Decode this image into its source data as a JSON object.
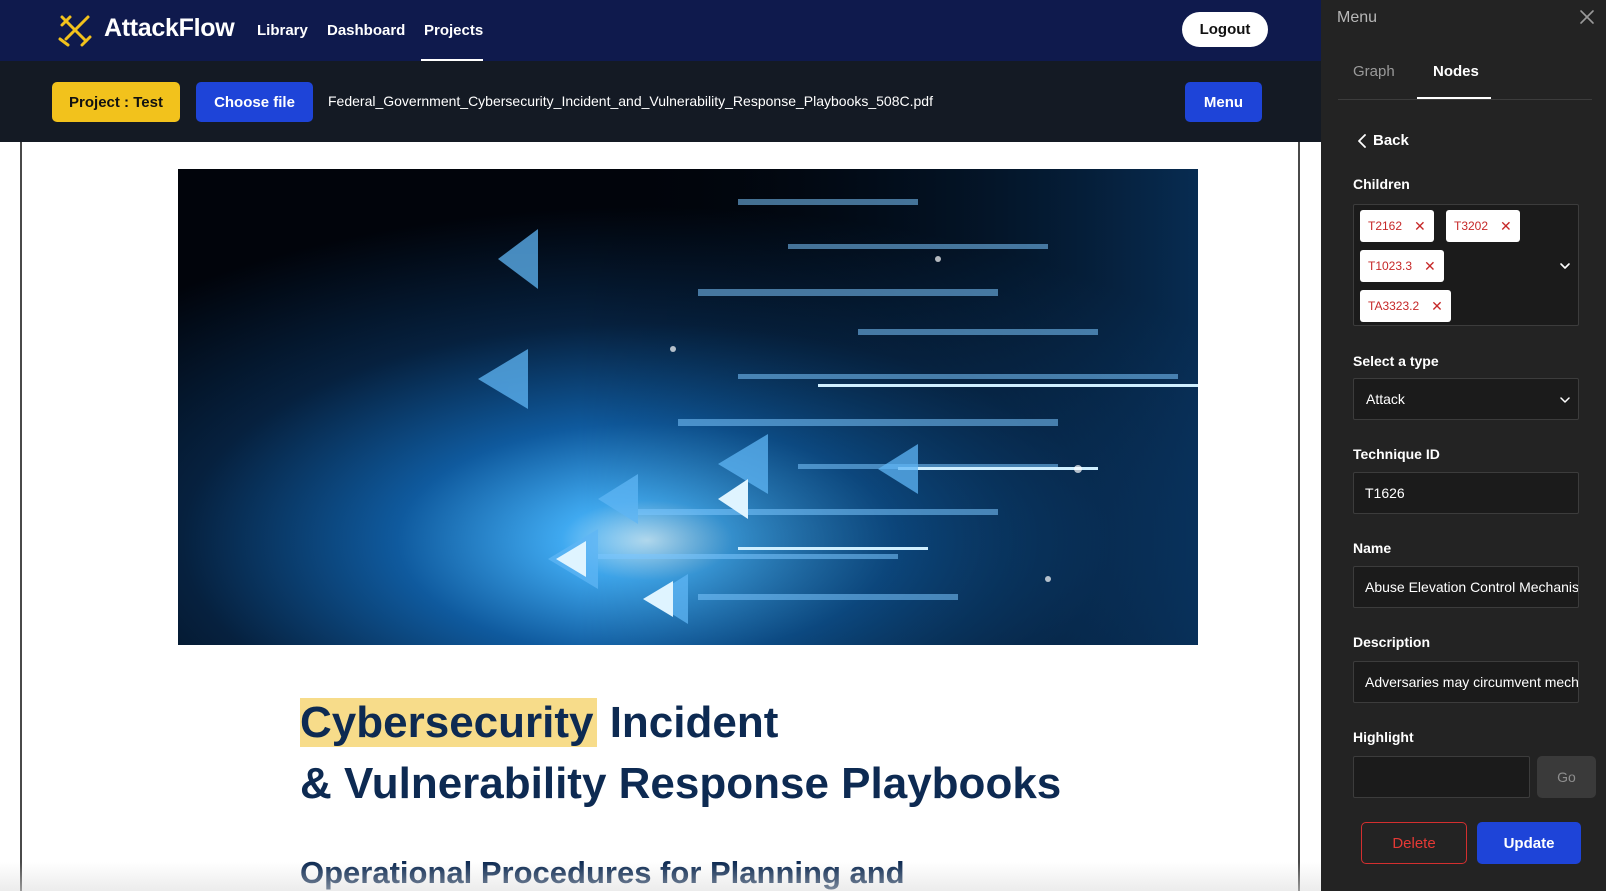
{
  "app": {
    "brand": "AttackFlow"
  },
  "nav": {
    "links": [
      {
        "label": "Library"
      },
      {
        "label": "Dashboard"
      },
      {
        "label": "Projects"
      }
    ],
    "logout_label": "Logout"
  },
  "toolbar": {
    "project_label": "Project : Test",
    "choose_file_label": "Choose file",
    "filename": "Federal_Government_Cybersecurity_Incident_and_Vulnerability_Response_Playbooks_508C.pdf",
    "menu_label": "Menu"
  },
  "document": {
    "title_highlight": "Cybersecurity",
    "title_rest_line1": " Incident",
    "title_line2": "& Vulnerability Response Playbooks",
    "subtitle": "Operational Procedures for Planning and"
  },
  "panel": {
    "title": "Menu",
    "tabs": [
      {
        "label": "Graph"
      },
      {
        "label": "Nodes"
      }
    ],
    "active_tab": "Nodes",
    "back_label": "Back",
    "children_label": "Children",
    "children": [
      "T2162",
      "T3202",
      "T1023.3",
      "TA3323.2"
    ],
    "type_label": "Select a type",
    "type_value": "Attack",
    "technique_label": "Technique ID",
    "technique_value": "T1626",
    "name_label": "Name",
    "name_value": "Abuse Elevation Control Mechanism",
    "description_label": "Description",
    "description_value": "Adversaries may circumvent mechanisms",
    "highlight_label": "Highlight",
    "highlight_value": "",
    "go_label": "Go",
    "delete_label": "Delete",
    "update_label": "Update"
  },
  "colors": {
    "nav_bg": "#0f1a4d",
    "toolbar_bg": "#141a24",
    "accent_yellow": "#f2c21c",
    "accent_blue": "#1e44d8",
    "panel_bg": "#232323",
    "danger": "#d32f2f",
    "doc_title": "#0d2a52"
  }
}
